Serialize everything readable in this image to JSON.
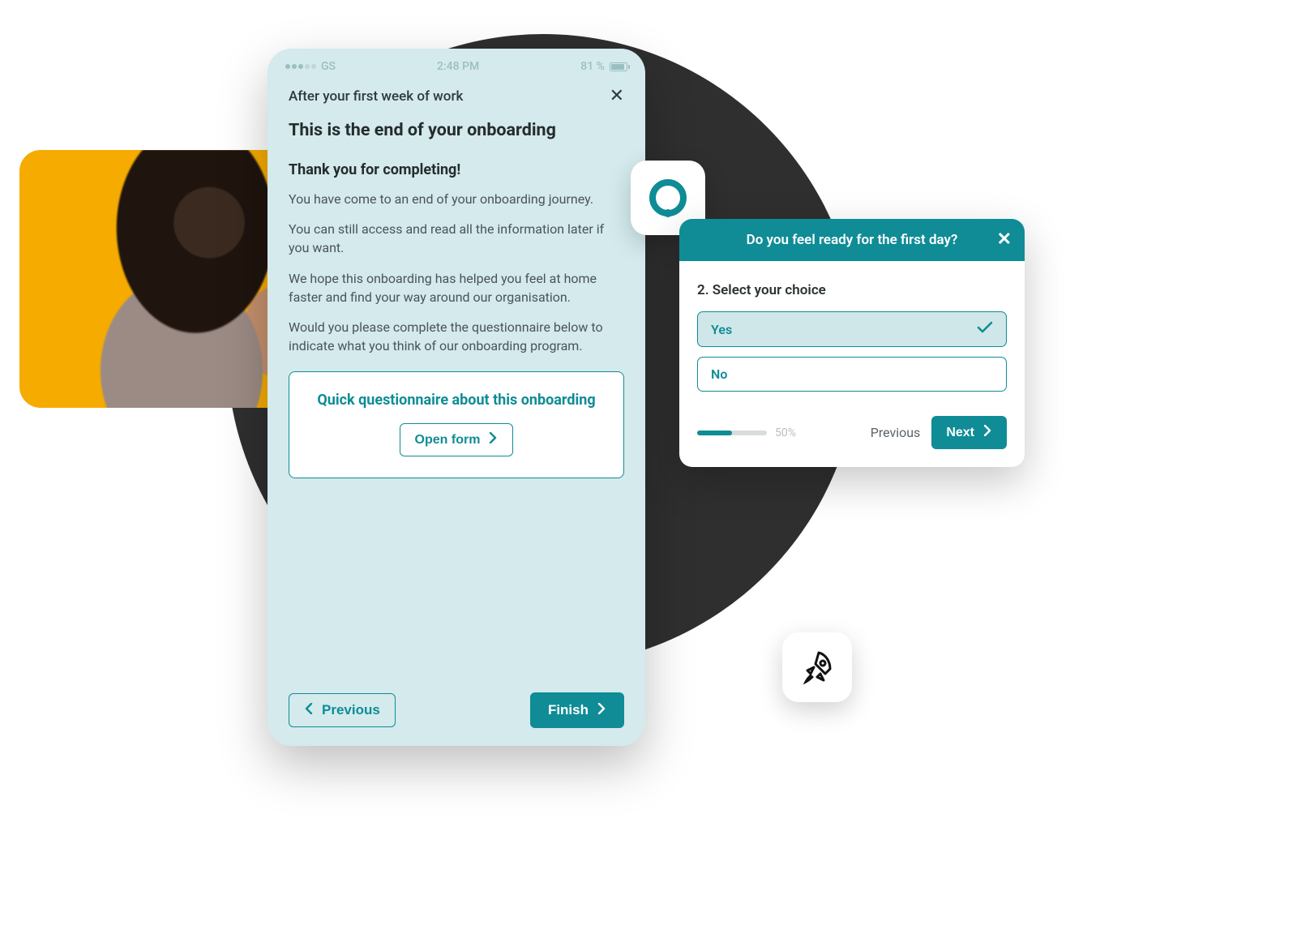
{
  "colors": {
    "accent": "#0f8c96",
    "dark": "#2f2f30",
    "yellow": "#f5ab00",
    "pale": "#d4eaec"
  },
  "phone": {
    "status": {
      "carrier": "GS",
      "time": "2:48 PM",
      "battery_pct": "81 %"
    },
    "header_title": "After your first week of work",
    "title": "This is the end of your onboarding",
    "subtitle": "Thank you for completing!",
    "paragraphs": [
      "You have come to an end of your onboarding journey.",
      "You can still access and read all the information later if you want.",
      "We hope this onboarding has helped you feel at home faster and find your way around our organisation.",
      "Would you please complete the questionnaire below to indicate what you think of our onboarding program."
    ],
    "form_card": {
      "title": "Quick questionnaire about this onboarding",
      "open_label": "Open form"
    },
    "prev_label": "Previous",
    "finish_label": "Finish"
  },
  "quiz": {
    "header": "Do you feel ready for the first day?",
    "question": "2. Select your choice",
    "options": [
      "Yes",
      "No"
    ],
    "selected_index": 0,
    "progress_pct": "50%",
    "prev_label": "Previous",
    "next_label": "Next"
  }
}
